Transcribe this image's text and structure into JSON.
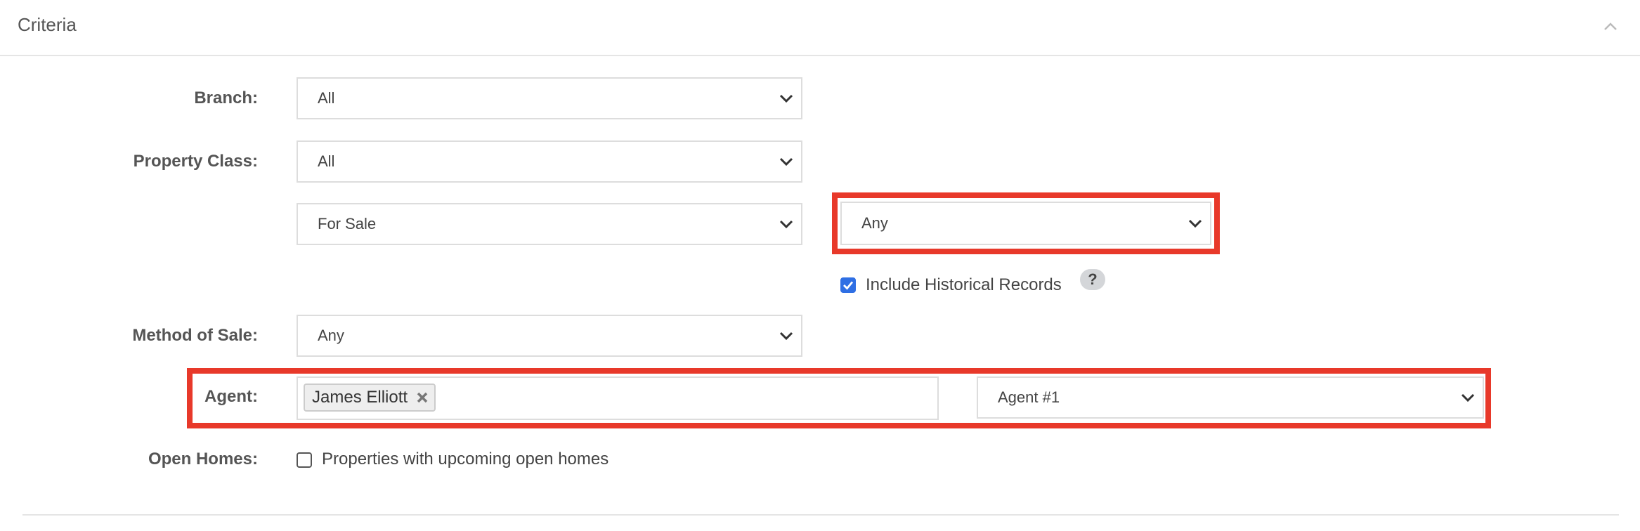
{
  "panel": {
    "title": "Criteria"
  },
  "branch": {
    "label": "Branch:",
    "value": "All"
  },
  "property_class": {
    "label": "Property Class:",
    "value": "All",
    "status_value": "For Sale",
    "sub_status_value": "Any",
    "include_historical": {
      "label": "Include Historical Records",
      "checked": true
    },
    "help_label": "?"
  },
  "method_of_sale": {
    "label": "Method of Sale:",
    "value": "Any"
  },
  "agent": {
    "label": "Agent:",
    "selected_tags": [
      "James Elliott"
    ],
    "role_value": "Agent #1"
  },
  "open_homes": {
    "label": "Open Homes:",
    "checkbox_label": "Properties with upcoming open homes",
    "checked": false
  },
  "colors": {
    "highlight": "#e8392a",
    "checkbox_blue": "#2f6fe4"
  }
}
